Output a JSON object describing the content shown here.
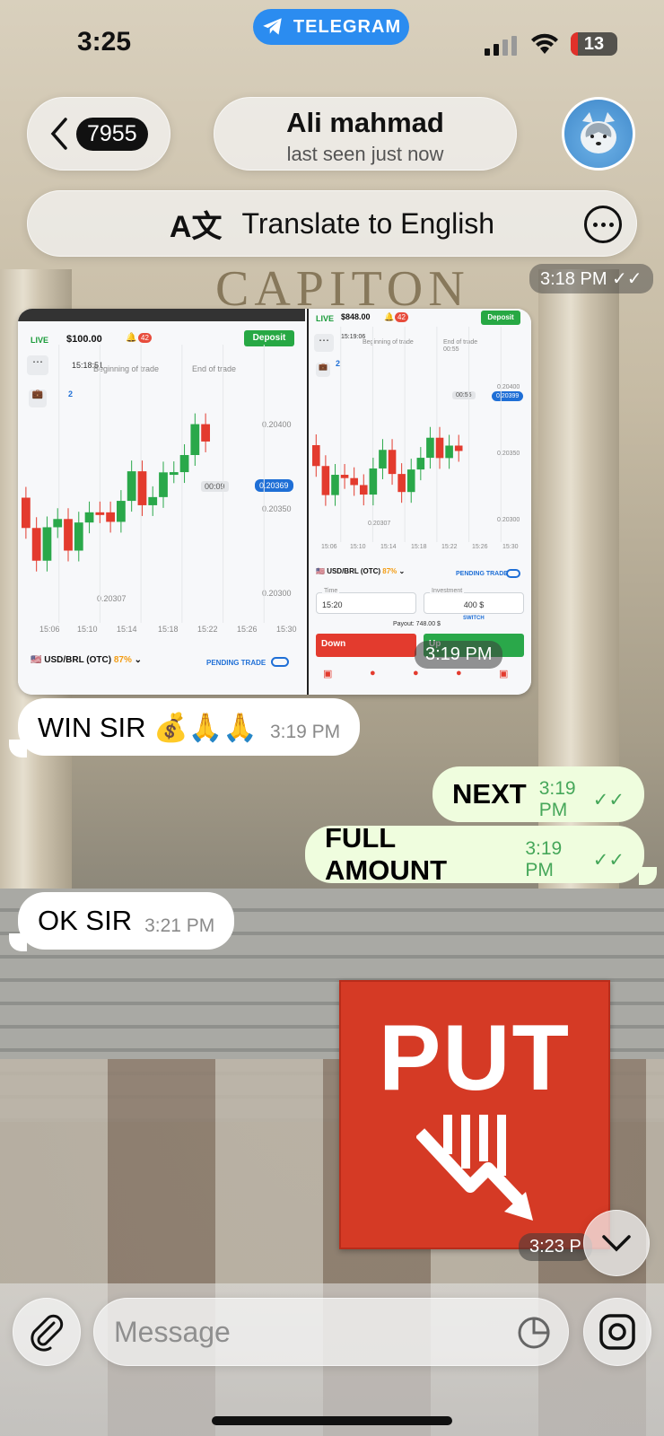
{
  "status_bar": {
    "time": "3:25",
    "app_pill": "TELEGRAM",
    "battery": "13",
    "battery_color": "#e0302a"
  },
  "header": {
    "back_count": "7955",
    "chat_name": "Ali mahmad",
    "chat_status": "last seen just now",
    "avatar_icon": "husky-avatar-icon"
  },
  "translate_bar": {
    "label": "Translate to English"
  },
  "messages": {
    "prev_time": "3:18 PM",
    "media_time": "3:19 PM",
    "msg1": {
      "text": "WIN SIR 💰🙏🙏",
      "time": "3:19 PM"
    },
    "msg2": {
      "text": "NEXT",
      "time": "3:19 PM"
    },
    "msg3": {
      "text": "FULL AMOUNT",
      "time": "3:19 PM"
    },
    "msg4": {
      "text": "OK SIR",
      "time": "3:21 PM"
    },
    "sticker": {
      "text": "PUT",
      "time": "3:23 P"
    }
  },
  "screenshot_left": {
    "live": "LIVE",
    "balance": "$100.00",
    "notif": "42",
    "deposit": "Deposit",
    "time_marker": "15:18:51",
    "beginning": "Beginning of trade",
    "end": "End of trade",
    "price": "0.20369",
    "timer": "00:09",
    "y1": "0.20400",
    "y2": "0.20350",
    "y3": "0.20300",
    "low": "0.20307",
    "x_labels": [
      "15:06",
      "15:10",
      "15:14",
      "15:18",
      "15:22",
      "15:26",
      "15:30"
    ],
    "pair": "USD/BRL (OTC)",
    "pct": "87%",
    "pending": "PENDING TRADE",
    "counter": "2"
  },
  "screenshot_right": {
    "live": "LIVE",
    "balance": "$848.00",
    "notif": "42",
    "deposit": "Deposit",
    "time_marker": "15:19:06",
    "beginning": "Beginning of trade",
    "end": "End of trade",
    "end_sub": "00:55",
    "price": "0.20399",
    "timer": "00:55",
    "y1": "0.20400",
    "y2": "0.20350",
    "y3": "0.20300",
    "low": "0.20307",
    "x_labels": [
      "15:06",
      "15:10",
      "15:14",
      "15:18",
      "15:22",
      "15:26",
      "15:30"
    ],
    "pair": "USD/BRL (OTC)",
    "pct": "87%",
    "pending": "PENDING TRADE",
    "time_label": "Time",
    "time_value": "15:20",
    "investment_label": "Investment",
    "investment_value": "400 $",
    "switch": "SWITCH",
    "payout": "Payout: 748.00 $",
    "down": "Down",
    "up": "Up",
    "counter": "2"
  },
  "composer": {
    "placeholder": "Message"
  },
  "colors": {
    "telegram_blue": "#2b8cf0",
    "outgoing_bubble": "#effdde",
    "incoming_bubble": "#ffffff",
    "read_check": "#46a75a",
    "put_red": "#d53a25"
  }
}
